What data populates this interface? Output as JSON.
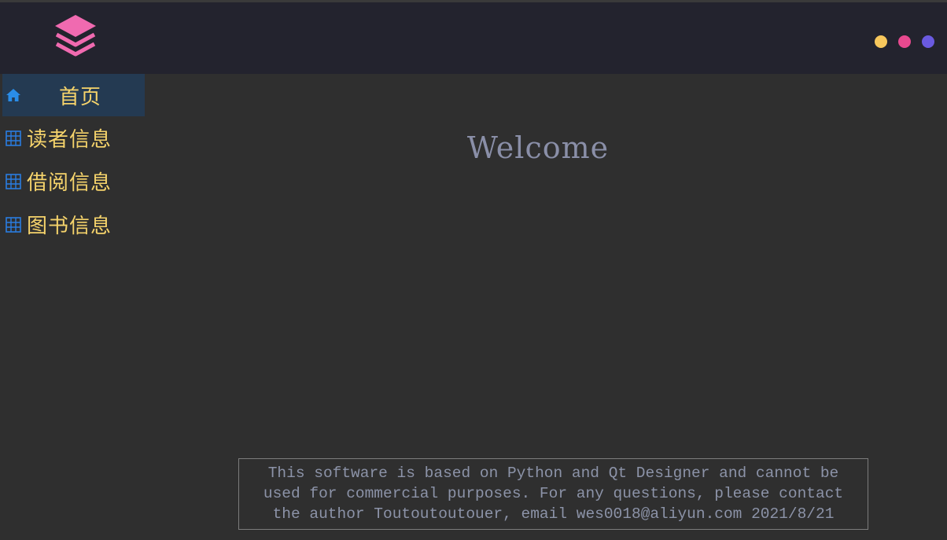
{
  "header": {
    "logo_icon": "layers-icon",
    "logo_color": "#f06ab0",
    "window_controls": [
      {
        "name": "minimize-dot",
        "color": "#f7c75c"
      },
      {
        "name": "maximize-dot",
        "color": "#e8498f"
      },
      {
        "name": "close-dot",
        "color": "#6a5ae0"
      }
    ]
  },
  "sidebar": {
    "items": [
      {
        "label": "首页",
        "icon": "home-icon",
        "active": true
      },
      {
        "label": "读者信息",
        "icon": "table-icon",
        "active": false
      },
      {
        "label": "借阅信息",
        "icon": "table-icon",
        "active": false
      },
      {
        "label": "图书信息",
        "icon": "table-icon",
        "active": false
      }
    ],
    "text_color": "#f5d36b",
    "active_bg": "#243a52",
    "icon_color": "#2a7de1"
  },
  "main": {
    "welcome_text": "Welcome",
    "notice_lines": [
      "This software is based on Python and Qt Designer and cannot be",
      "used for commercial purposes. For any questions, please contact",
      "the author Toutoutoutouer, email wes0018@aliyun.com 2021/8/21"
    ]
  }
}
